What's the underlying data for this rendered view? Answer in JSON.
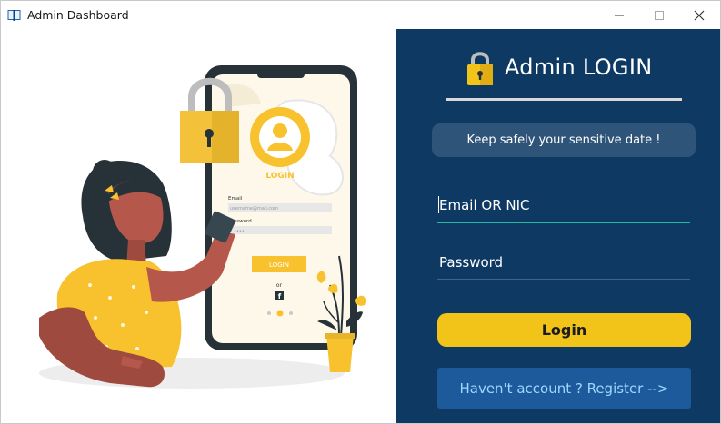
{
  "window": {
    "title": "Admin Dashboard",
    "controls": [
      "minimize-icon",
      "maximize-icon",
      "close-icon"
    ]
  },
  "illustration": {
    "phone_heading": "LOGIN",
    "email_label": "Email",
    "email_placeholder": "username@mail.com",
    "password_label": "Password",
    "password_dots": "••••",
    "login_button": "LOGIN",
    "or_text": "or",
    "social_icon": "facebook-icon",
    "carousel_dots": 3
  },
  "panel": {
    "icon": "lock-icon",
    "title": "Admin LOGIN",
    "info": "Keep safely your sensitive date !",
    "email_placeholder": "Email OR NIC",
    "password_placeholder": "Password",
    "login_button": "Login",
    "register_button": "Haven't account ? Register -->"
  },
  "colors": {
    "panel_bg": "#0d3963",
    "accent_yellow": "#f2c318",
    "register_bg": "#1d5a9b",
    "register_text": "#9fd6ff",
    "input_focus": "#21b8a6",
    "info_box": "#2e5479"
  }
}
